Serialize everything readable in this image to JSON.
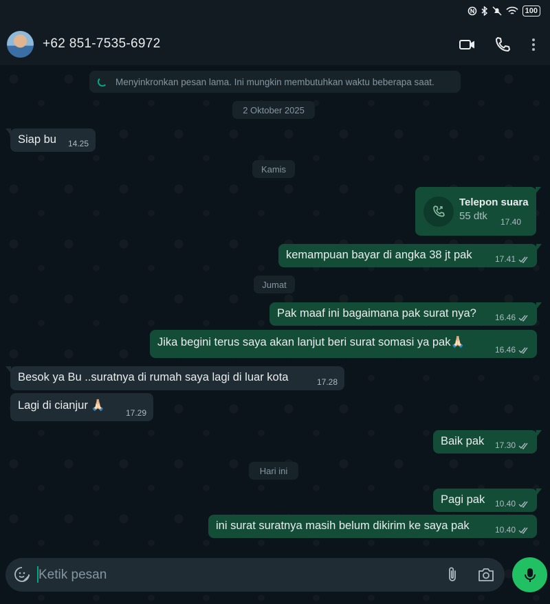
{
  "status_bar": {
    "battery": "100"
  },
  "header": {
    "contact_name": "+62 851-7535-6972"
  },
  "sync_banner": {
    "text": "Menyinkronkan pesan lama. Ini mungkin membutuhkan waktu beberapa saat."
  },
  "date_labels": [
    "2 Oktober 2025",
    "Kamis",
    "Jumat",
    "Hari ini"
  ],
  "messages": [
    {
      "dir": "in",
      "text": "Siap bu",
      "time": "14.25"
    },
    {
      "dir": "out",
      "type": "call",
      "title": "Telepon suara",
      "duration": "55 dtk",
      "time": "17.40"
    },
    {
      "dir": "out",
      "text": "kemampuan bayar di angka 38 jt pak",
      "time": "17.41"
    },
    {
      "dir": "out",
      "text": "Pak maaf ini bagaimana pak surat nya?",
      "time": "16.46"
    },
    {
      "dir": "out",
      "text": "Jika begini terus saya akan lanjut beri surat somasi ya pak🙏🏻",
      "time": "16.46"
    },
    {
      "dir": "in",
      "text": "Besok ya Bu ..suratnya di rumah saya lagi di luar kota",
      "time": "17.28"
    },
    {
      "dir": "in",
      "text": "Lagi di cianjur 🙏🏻",
      "time": "17.29"
    },
    {
      "dir": "out",
      "text": "Baik pak",
      "time": "17.30"
    },
    {
      "dir": "out",
      "text": "Pagi pak",
      "time": "10.40"
    },
    {
      "dir": "out",
      "text": "ini surat suratnya masih belum dikirim ke saya pak",
      "time": "10.40"
    }
  ],
  "composer": {
    "placeholder": "Ketik pesan"
  },
  "colors": {
    "accent": "#21c063",
    "outgoing_bubble": "#144d37",
    "incoming_bubble": "#202c33",
    "background": "#0b141a"
  },
  "icons": [
    "back-avatar",
    "video-call-icon",
    "voice-call-icon",
    "more-options-icon",
    "sticker-icon",
    "attach-icon",
    "camera-icon",
    "mic-icon",
    "read-ticks-icon",
    "phone-icon"
  ]
}
